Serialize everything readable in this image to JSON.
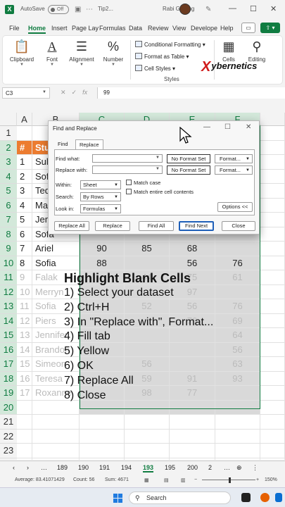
{
  "titlebar": {
    "autosave": "AutoSave",
    "toggle": "Off",
    "filename": "Tip2...",
    "username": "Rabi Gurung",
    "minimize": "—",
    "restore": "☐",
    "close": "✕"
  },
  "ribbon_tabs": [
    "File",
    "Home",
    "Insert",
    "Page Lay",
    "Formulas",
    "Data",
    "Review",
    "View",
    "Develope",
    "Help"
  ],
  "ribbon": {
    "clipboard": "Clipboard",
    "font": "Font",
    "alignment": "Alignment",
    "number": "Number",
    "conditional_formatting": "Conditional Formatting",
    "format_as_table": "Format as Table",
    "cell_styles": "Cell Styles",
    "styles_group": "Styles",
    "cells": "Cells",
    "editing": "Editing",
    "watermark": "ybernetics"
  },
  "formula_bar": {
    "name_box": "C3",
    "formula": "99"
  },
  "grid": {
    "columns": [
      "A",
      "B",
      "C",
      "D",
      "E",
      "F"
    ],
    "rows": [
      "1",
      "2",
      "3",
      "4",
      "5",
      "6",
      "7",
      "8",
      "9",
      "10",
      "11",
      "12",
      "13",
      "14",
      "15",
      "16",
      "17",
      "18",
      "19",
      "20",
      "21",
      "22",
      "23",
      "24"
    ],
    "header_row": {
      "a": "#",
      "b": "Stu"
    },
    "data_rows": [
      {
        "a": "1",
        "b": "Sula"
      },
      {
        "a": "2",
        "b": "Sofi"
      },
      {
        "a": "3",
        "b": "Tedd"
      },
      {
        "a": "4",
        "b": "Mar"
      },
      {
        "a": "5",
        "b": "Jen"
      },
      {
        "a": "6",
        "b": "Sofa"
      },
      {
        "a": "7",
        "b": "Ariel",
        "c": "90",
        "d": "85",
        "e": "68",
        "f": ""
      },
      {
        "a": "8",
        "b": "Sofia",
        "c": "88",
        "d": "",
        "e": "56",
        "f": "76"
      },
      {
        "a": "9",
        "b": "Falak",
        "c": "",
        "d": "44",
        "e": "75",
        "f": "61"
      },
      {
        "a": "10",
        "b": "Merryn",
        "c": "",
        "d": "",
        "e": "97",
        "f": ""
      },
      {
        "a": "11",
        "b": "Sofia",
        "c": "",
        "d": "52",
        "e": "56",
        "f": "76"
      },
      {
        "a": "12",
        "b": "Piers",
        "c": "",
        "d": "",
        "e": "76",
        "f": "69"
      },
      {
        "a": "13",
        "b": "Jennifer",
        "c": "",
        "d": "",
        "e": "",
        "f": "64"
      },
      {
        "a": "14",
        "b": "Brandon",
        "c": "",
        "d": "",
        "e": "",
        "f": "56"
      },
      {
        "a": "15",
        "b": "Simeon",
        "c": "",
        "d": "56",
        "e": "",
        "f": "63"
      },
      {
        "a": "16",
        "b": "Teresa",
        "c": "",
        "d": "59",
        "e": "91",
        "f": "93"
      },
      {
        "a": "17",
        "b": "Roxanne",
        "c": "",
        "d": "98",
        "e": "77",
        "f": ""
      }
    ]
  },
  "dialog": {
    "title": "Find and Replace",
    "tab_find": "Find",
    "tab_replace": "Replace",
    "find_what_label": "Find what:",
    "replace_with_label": "Replace with:",
    "no_format_set": "No Format Set",
    "format_btn": "Format...",
    "within_label": "Within:",
    "within_value": "Sheet",
    "search_label": "Search:",
    "search_value": "By Rows",
    "look_in_label": "Look in:",
    "look_in_value": "Formulas",
    "match_case": "Match case",
    "match_entire": "Match entire cell contents",
    "options_btn": "Options <<",
    "replace_all": "Replace All",
    "replace": "Replace",
    "find_all": "Find All",
    "find_next": "Find Next",
    "close": "Close"
  },
  "tutorial": {
    "title": "Highlight Blank Cells",
    "steps": [
      "1) Select your dataset",
      "2) Ctrl+H",
      "3) In \"Replace with\", Format...",
      "4) Fill tab",
      "5) Yellow",
      "6) OK",
      "7) Replace All",
      "8) Close"
    ]
  },
  "sheet_tabs": [
    "189",
    "190",
    "191",
    "194",
    "193",
    "195",
    "200",
    "2"
  ],
  "active_sheet": "193",
  "status": {
    "average": "Average: 83.41071429",
    "count": "Count: 56",
    "sum": "Sum: 4671",
    "zoom": "150%"
  },
  "taskbar": {
    "search": "Search"
  },
  "colors": {
    "excel_green": "#107c41",
    "header_orange": "#ec7c30",
    "selection_fill": "#d9d9d9",
    "watermark_red": "#d01c1c"
  }
}
